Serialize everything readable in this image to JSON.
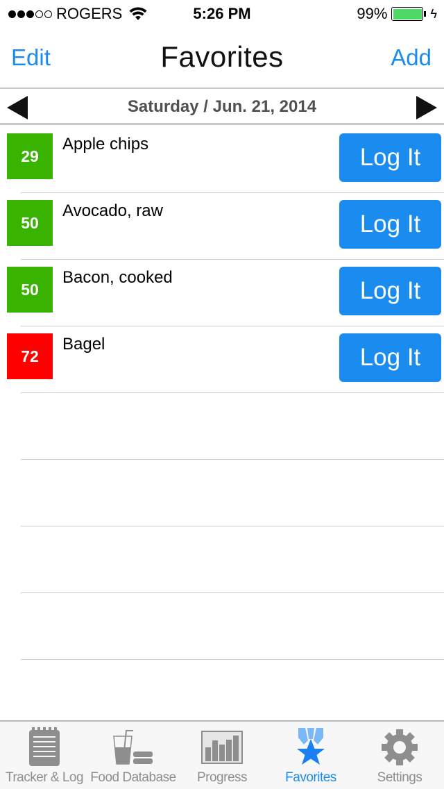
{
  "status_bar": {
    "signal_full": 3,
    "signal_total": 5,
    "carrier": "ROGERS",
    "time": "5:26 PM",
    "battery_percent": "99%",
    "battery_level": 0.99,
    "charging_icon": "bolt-icon"
  },
  "nav": {
    "title": "Favorites",
    "left_button": "Edit",
    "right_button": "Add"
  },
  "date_bar": {
    "date": "Saturday / Jun. 21, 2014",
    "prev_icon": "triangle-left-icon",
    "next_icon": "triangle-right-icon"
  },
  "colors": {
    "accent": "#1a8cf0",
    "score_low": "#37b300",
    "score_high": "#ff0000"
  },
  "favorites": [
    {
      "score": "29",
      "level": "low",
      "name": "Apple chips",
      "action": "Log It"
    },
    {
      "score": "50",
      "level": "low",
      "name": "Avocado, raw",
      "action": "Log It"
    },
    {
      "score": "50",
      "level": "low",
      "name": "Bacon, cooked",
      "action": "Log It"
    },
    {
      "score": "72",
      "level": "high",
      "name": "Bagel",
      "action": "Log It"
    }
  ],
  "empty_rows": 5,
  "tabs": [
    {
      "label": "Tracker & Log",
      "icon": "notepad-icon",
      "active": false
    },
    {
      "label": "Food Database",
      "icon": "drink-burger-icon",
      "active": false
    },
    {
      "label": "Progress",
      "icon": "bar-chart-icon",
      "active": false
    },
    {
      "label": "Favorites",
      "icon": "medal-star-icon",
      "active": true
    },
    {
      "label": "Settings",
      "icon": "gear-icon",
      "active": false
    }
  ]
}
